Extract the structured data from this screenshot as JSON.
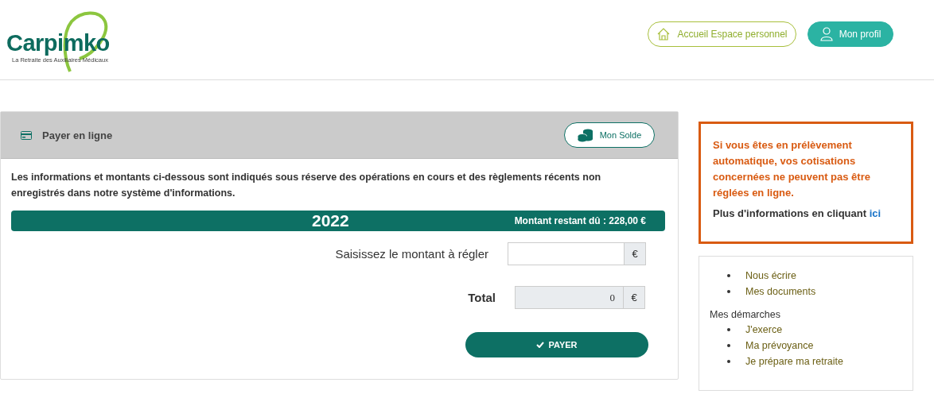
{
  "header": {
    "logo": {
      "name": "Carpimko",
      "tagline": "La Retraite des Auxiliaires Médicaux"
    },
    "buttons": [
      {
        "label": "Accueil Espace personnel",
        "kind": "home"
      },
      {
        "label": "Mon profil",
        "kind": "profile"
      }
    ]
  },
  "payment": {
    "title": "Payer en ligne",
    "balance_button": "Mon Solde",
    "notice": "Les informations et montants ci-dessous sont indiqués sous réserve des opérations en cours et des règlements récents non enregistrés dans notre système d'informations.",
    "year": "2022",
    "remaining": "Montant restant dû : 228,00 €",
    "amount_label": "Saisissez le montant à régler",
    "amount_unit": "€",
    "total_label": "Total",
    "total_value": "0",
    "total_unit": "€",
    "pay_button": "PAYER"
  },
  "alert": {
    "message": "Si vous êtes en prélèvement automatique, vos cotisations concernées ne peuvent pas être réglées en ligne.",
    "more": "Plus d'informations en cliquant",
    "link": "ici"
  },
  "links": {
    "top": [
      "Nous écrire",
      "Mes documents"
    ],
    "section": "Mes démarches",
    "section_items": [
      "J'exerce",
      "Ma prévoyance",
      "Je prépare ma retraite"
    ]
  }
}
